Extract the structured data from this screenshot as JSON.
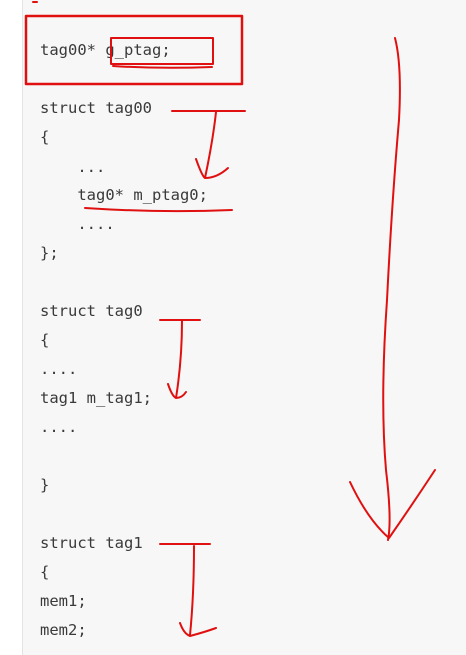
{
  "code_lines": [
    "tag00* g_ptag;",
    "struct tag00",
    "{",
    "    ...",
    "    tag0* m_ptag0;",
    "    ....",
    "};",
    "struct tag0",
    "{",
    "....",
    "tag1 m_tag1;",
    "....",
    "}",
    "struct tag1",
    "{",
    "mem1;",
    "mem2;"
  ],
  "annotation_color": "#e01010"
}
